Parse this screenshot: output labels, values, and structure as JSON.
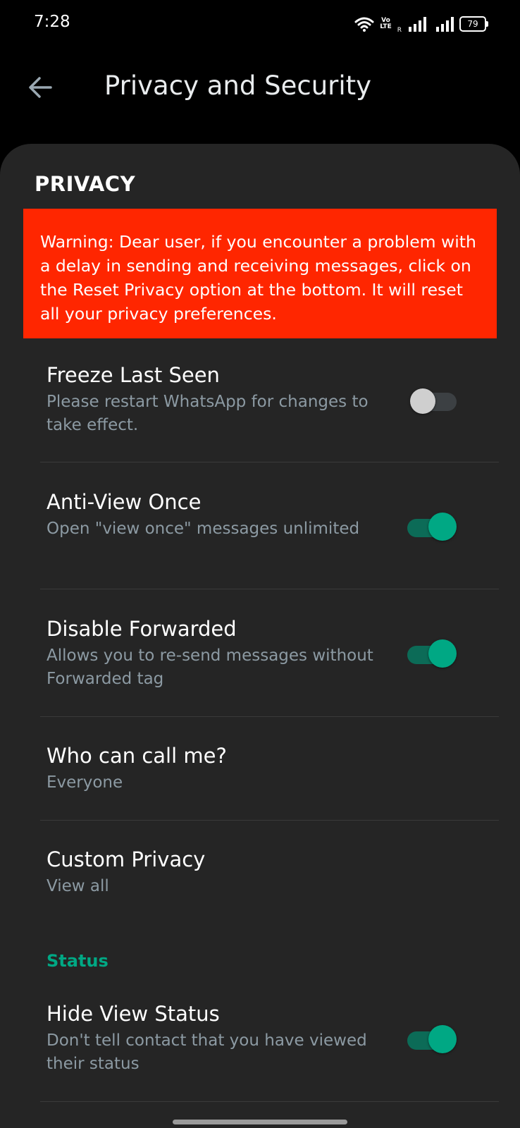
{
  "status_bar": {
    "time": "7:28",
    "volte_top": "Vo",
    "volte_bottom": "LTE",
    "roaming": "R",
    "battery": "79"
  },
  "app_bar": {
    "back_icon": "arrow-left-icon",
    "title": "Privacy and Security"
  },
  "section": {
    "header": "PRIVACY",
    "warning": "Warning: Dear user, if you encounter a problem with a delay in sending and receiving messages, click on the Reset Privacy option at the bottom. It will reset all your privacy preferences."
  },
  "items": [
    {
      "title": "Freeze Last Seen",
      "subtitle": "Please restart WhatsApp for changes to take effect.",
      "toggle": "off"
    },
    {
      "title": "Anti-View Once",
      "subtitle": "Open \"view once\" messages unlimited",
      "toggle": "on"
    },
    {
      "title": "Disable Forwarded",
      "subtitle": "Allows you to re-send messages without Forwarded tag",
      "toggle": "on"
    },
    {
      "title": "Who can call me?",
      "subtitle": "Everyone"
    },
    {
      "title": "Custom Privacy",
      "subtitle": "View all"
    }
  ],
  "status_section": {
    "header": "Status",
    "items": [
      {
        "title": "Hide View Status",
        "subtitle": "Don't tell contact that you have viewed their status",
        "toggle": "on"
      }
    ]
  },
  "colors": {
    "accent": "#00a884",
    "warning_bg": "#ff2600",
    "sheet_bg": "#252525"
  }
}
